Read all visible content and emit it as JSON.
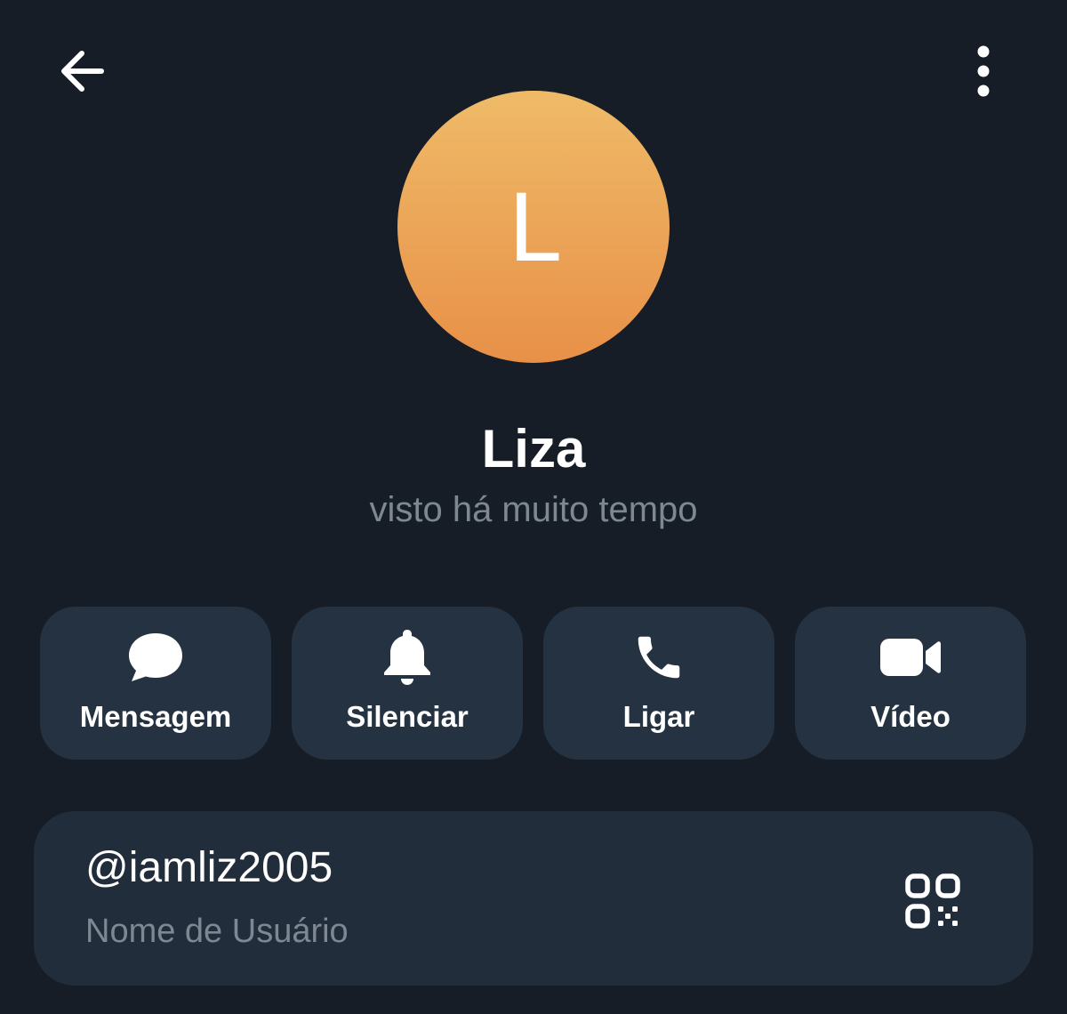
{
  "header": {
    "back_icon": "arrow-left-icon",
    "menu_icon": "more-vertical-icon"
  },
  "profile": {
    "avatar_letter": "L",
    "avatar_colors": [
      "#efbb68",
      "#e89048"
    ],
    "name": "Liza",
    "status": "visto há muito tempo"
  },
  "actions": [
    {
      "label": "Mensagem",
      "icon": "chat-bubble-icon"
    },
    {
      "label": "Silenciar",
      "icon": "bell-icon"
    },
    {
      "label": "Ligar",
      "icon": "phone-icon"
    },
    {
      "label": "Vídeo",
      "icon": "video-camera-icon"
    }
  ],
  "info": {
    "username": "@iamliz2005",
    "username_caption": "Nome de Usuário",
    "qr_icon": "qr-code-icon"
  },
  "colors": {
    "background": "#161d26",
    "button_bg": "#243241",
    "card_bg": "#212d3a",
    "muted_text": "#7d8893",
    "text": "#ffffff"
  }
}
